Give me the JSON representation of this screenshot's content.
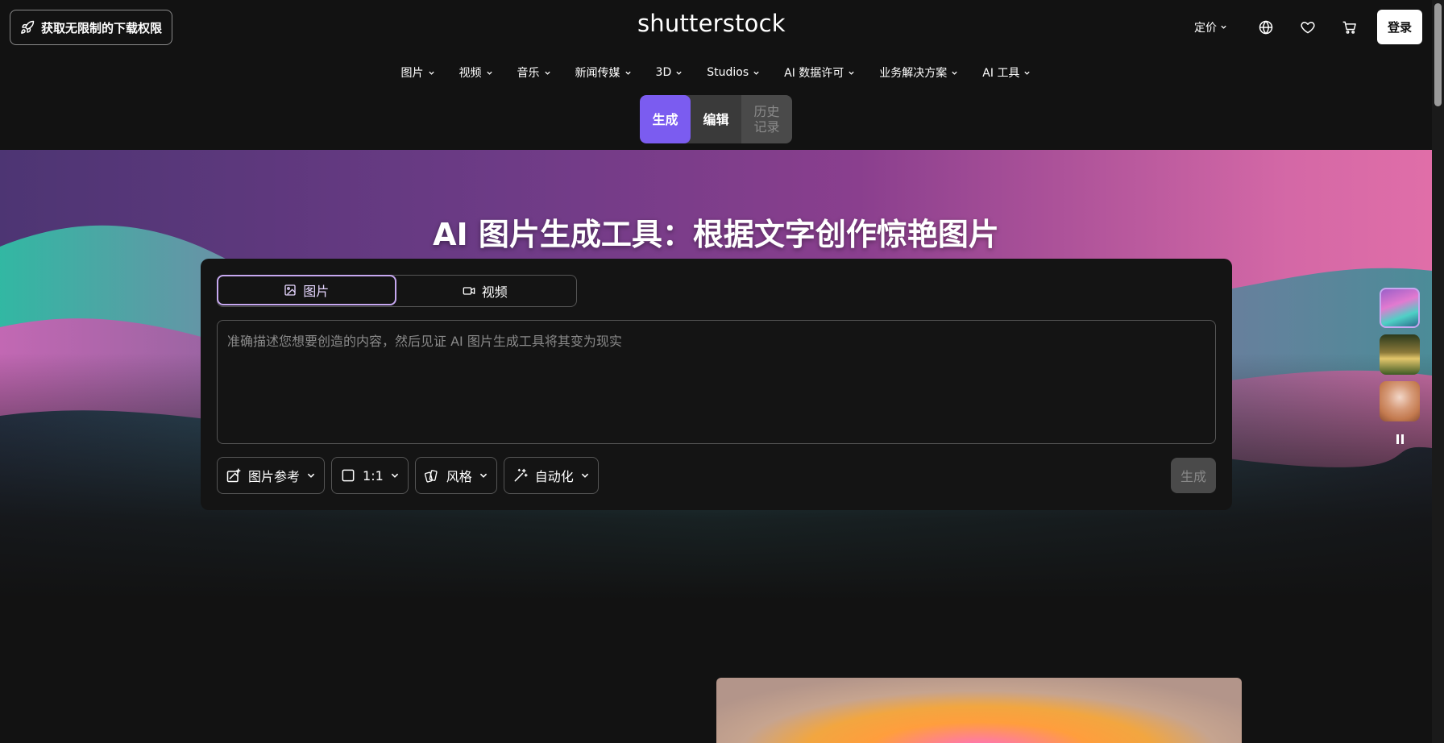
{
  "header": {
    "promo_label": "获取无限制的下载权限",
    "logo": "shutterstock",
    "pricing_label": "定价",
    "login_label": "登录",
    "icons": [
      "globe-icon",
      "heart-icon",
      "cart-icon"
    ]
  },
  "nav": {
    "items": [
      {
        "label": "图片"
      },
      {
        "label": "视频"
      },
      {
        "label": "音乐"
      },
      {
        "label": "新闻传媒"
      },
      {
        "label": "3D"
      },
      {
        "label": "Studios"
      },
      {
        "label": "AI 数据许可"
      },
      {
        "label": "业务解决方案"
      },
      {
        "label": "AI 工具"
      }
    ]
  },
  "mode_tabs": {
    "generate": "生成",
    "edit": "编辑",
    "history": "历史记录"
  },
  "hero": {
    "title": "AI 图片生成工具：根据文字创作惊艳图片"
  },
  "panel": {
    "tabs": {
      "image": "图片",
      "video": "视频"
    },
    "prompt_placeholder": "准确描述您想要创造的内容，然后见证 AI 图片生成工具将其变为现实",
    "controls": {
      "image_reference": "图片参考",
      "aspect_ratio": "1:1",
      "style": "风格",
      "automation": "自动化"
    },
    "generate_label": "生成"
  },
  "colors": {
    "accent": "#7b5cf0",
    "tab_active_border": "#c6a8f0",
    "background": "#121212"
  }
}
